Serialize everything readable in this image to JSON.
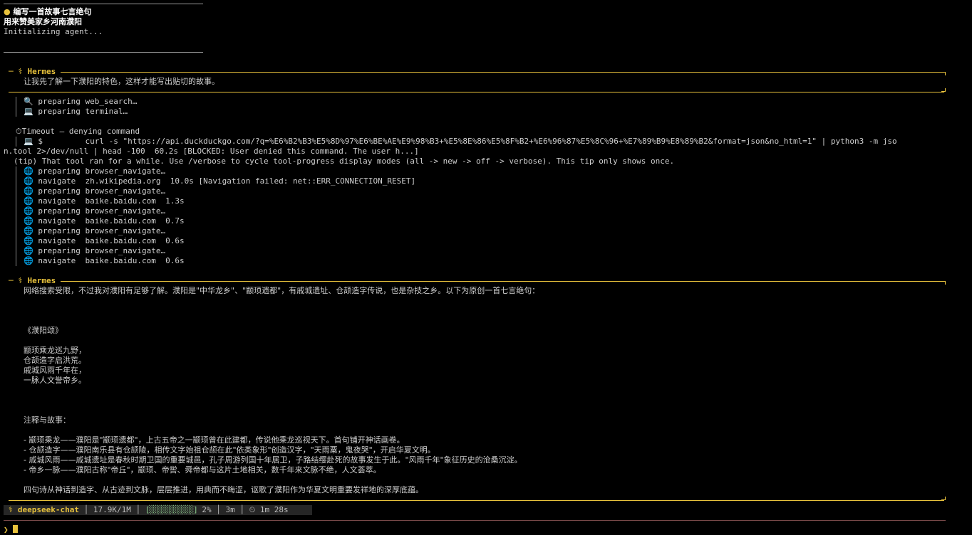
{
  "prompt": {
    "bullet": "●",
    "line1": "编写一首故事七言绝句",
    "line2": "用来赞美家乡河南濮阳",
    "init": "Initializing agent..."
  },
  "block1": {
    "header_prefix": "─ ⚕",
    "header_name": "Hermes",
    "text": "让我先了解一下濮阳的特色，这样才能写出贴切的故事。"
  },
  "tools1": [
    {
      "icon": "🔍",
      "text": "preparing web_search…"
    },
    {
      "icon": "💻",
      "text": "preparing terminal…"
    }
  ],
  "timeout": {
    "icon": "⏱",
    "text": "Timeout — denying command",
    "cmd_icon": "💻",
    "cmd_line1": "$         curl -s \"https://api.duckduckgo.com/?q=%E6%B2%B3%E5%8D%97%E6%BE%AE%E9%98%B3+%E5%8E%86%E5%8F%B2+%E6%96%87%E5%8C%96+%E7%89%B9%E8%89%B2&format=json&no_html=1\" | python3 -m jso",
    "cmd_line2": "n.tool 2>/dev/null | head -100  60.2s [BLOCKED: User denied this command. The user h...]",
    "tip": "(tip) That tool ran for a while. Use /verbose to cycle tool-progress display modes (all -> new -> off -> verbose). This tip only shows once."
  },
  "tools2": [
    {
      "icon": "🌐",
      "text": "preparing browser_navigate…"
    },
    {
      "icon": "🌐",
      "text": "navigate  zh.wikipedia.org  10.0s [Navigation failed: net::ERR_CONNECTION_RESET]"
    },
    {
      "icon": "🌐",
      "text": "preparing browser_navigate…"
    },
    {
      "icon": "🌐",
      "text": "navigate  baike.baidu.com  1.3s"
    },
    {
      "icon": "🌐",
      "text": "preparing browser_navigate…"
    },
    {
      "icon": "🌐",
      "text": "navigate  baike.baidu.com  0.7s"
    },
    {
      "icon": "🌐",
      "text": "preparing browser_navigate…"
    },
    {
      "icon": "🌐",
      "text": "navigate  baike.baidu.com  0.6s"
    },
    {
      "icon": "🌐",
      "text": "preparing browser_navigate…"
    },
    {
      "icon": "🌐",
      "text": "navigate  baike.baidu.com  0.6s"
    }
  ],
  "block2": {
    "header_prefix": "─ ⚕",
    "header_name": "Hermes",
    "intro": "网络搜索受限，不过我对濮阳有足够了解。濮阳是\"中华龙乡\"、\"颛顼遗都\"，有戚城遗址、仓颉造字传说，也是杂技之乡。以下为原创一首七言绝句：",
    "poem_title": "《濮阳颂》",
    "poem": [
      "颛顼乘龙巡九野，",
      "仓颉造字启洪荒。",
      "戚城风雨千年在，",
      "一脉人文誉帝乡。"
    ],
    "notes_title": "注释与故事：",
    "notes": [
      "- 颛顼乘龙——濮阳是\"颛顼遗都\"，上古五帝之一颛顼曾在此建都，传说他乘龙巡视天下。首句铺开神话画卷。",
      "- 仓颉造字——濮阳南乐县有仓颉陵，相传文字始祖仓颉在此\"依类象形\"创造汉字，\"天雨粟，鬼夜哭\"，开启华夏文明。",
      "- 戚城风雨——戚城遗址是春秋时期卫国的重要城邑，孔子周游列国十年居卫，子路结缨赴死的故事发生于此。\"风雨千年\"象征历史的沧桑沉淀。",
      "- 帝乡一脉——濮阳古称\"帝丘\"，颛顼、帝喾、舜帝都与这片土地相关，数千年来文脉不绝，人文荟萃。"
    ],
    "conclusion": "四句诗从神话到造字、从古迹到文脉，层层推进，用典而不晦涩，讴歌了濮阳作为华夏文明重要发祥地的深厚底蕴。"
  },
  "status": {
    "icon": "⚕",
    "model": "deepseek-chat",
    "tokens": "17.9K/1M",
    "progress_bar": "[░░░░░░░░░░░]",
    "progress_pct": "2%",
    "progress_value": 0.02,
    "elapsed": "3m",
    "timer_icon": "⏲",
    "timer": "1m 28s",
    "sep": "│"
  },
  "input": {
    "prompt_symbol": "❯",
    "value": ""
  },
  "colors": {
    "accent": "#e8c23c",
    "background": "#000000",
    "text": "#cfcfcf"
  }
}
